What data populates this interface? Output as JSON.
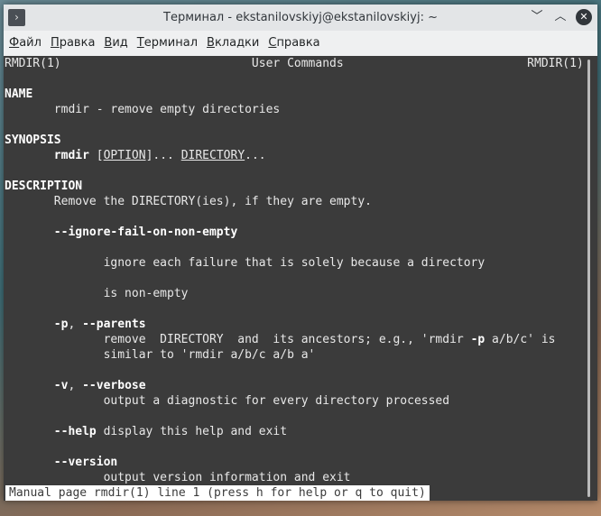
{
  "window": {
    "title": "Терминал - ekstanilovskiyj@ekstanilovskiyj: ~"
  },
  "menu": [
    "Файл",
    "Правка",
    "Вид",
    "Терминал",
    "Вкладки",
    "Справка"
  ],
  "lines": [
    [
      {
        "t": "RMDIR(1)                           User Commands                          RMDIR(1)"
      }
    ],
    [],
    [
      {
        "t": "NAME",
        "b": 1
      }
    ],
    [
      {
        "t": "       rmdir - remove empty directories"
      }
    ],
    [],
    [
      {
        "t": "SYNOPSIS",
        "b": 1
      }
    ],
    [
      {
        "t": "       "
      },
      {
        "t": "rmdir",
        "b": 1
      },
      {
        "t": " ["
      },
      {
        "t": "OPTION",
        "u": 1
      },
      {
        "t": "]... "
      },
      {
        "t": "DIRECTORY",
        "u": 1
      },
      {
        "t": "..."
      }
    ],
    [],
    [
      {
        "t": "DESCRIPTION",
        "b": 1
      }
    ],
    [
      {
        "t": "       Remove the DIRECTORY(ies), if they are empty."
      }
    ],
    [],
    [
      {
        "t": "       "
      },
      {
        "t": "--ignore-fail-on-non-empty",
        "b": 1
      }
    ],
    [],
    [
      {
        "t": "              ignore each failure that is solely because a directory"
      }
    ],
    [],
    [
      {
        "t": "              is non-empty"
      }
    ],
    [],
    [
      {
        "t": "       "
      },
      {
        "t": "-p",
        "b": 1
      },
      {
        "t": ", "
      },
      {
        "t": "--parents",
        "b": 1
      }
    ],
    [
      {
        "t": "              remove  DIRECTORY  and  its ancestors; e.g., 'rmdir "
      },
      {
        "t": "-p",
        "b": 1
      },
      {
        "t": " a/b/c' is"
      }
    ],
    [
      {
        "t": "              similar to 'rmdir a/b/c a/b a'"
      }
    ],
    [],
    [
      {
        "t": "       "
      },
      {
        "t": "-v",
        "b": 1
      },
      {
        "t": ", "
      },
      {
        "t": "--verbose",
        "b": 1
      }
    ],
    [
      {
        "t": "              output a diagnostic for every directory processed"
      }
    ],
    [],
    [
      {
        "t": "       "
      },
      {
        "t": "--help",
        "b": 1
      },
      {
        "t": " display this help and exit"
      }
    ],
    [],
    [
      {
        "t": "       "
      },
      {
        "t": "--version",
        "b": 1
      }
    ],
    [
      {
        "t": "              output version information and exit"
      }
    ]
  ],
  "status": "Manual page rmdir(1) line 1 (press h for help or q to quit)"
}
